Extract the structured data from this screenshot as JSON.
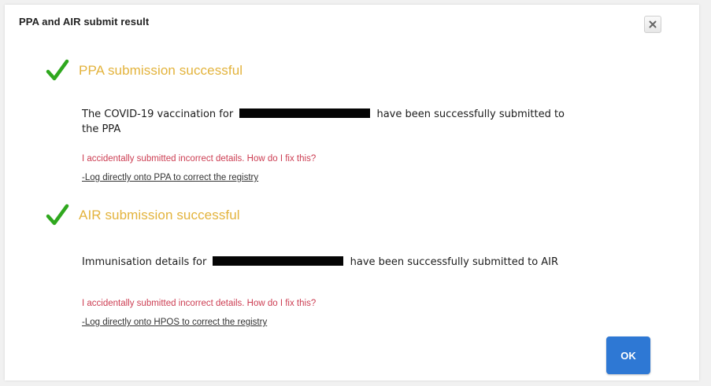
{
  "dialog": {
    "title": "PPA and AIR submit result",
    "close_icon": "close-x-icon",
    "ok_label": "OK"
  },
  "sections": [
    {
      "icon": "checkmark-icon",
      "heading": "PPA submission successful",
      "message_prefix": "The COVID-19 vaccination for",
      "message_suffix": "have been successfully submitted to",
      "message_line2": "the PPA",
      "help_question": "I accidentally submitted incorrect details. How do I fix this?",
      "fix_link": "-Log directly onto PPA to correct the registry"
    },
    {
      "icon": "checkmark-icon",
      "heading": "AIR submission successful",
      "message_prefix": "Immunisation details for",
      "message_suffix": "have been successfully submitted to AIR",
      "help_question": "I accidentally submitted incorrect details. How do I fix this?",
      "fix_link": "-Log directly onto HPOS to correct the registry"
    }
  ],
  "colors": {
    "heading": "#e3b33c",
    "check": "#2fa81e",
    "help_text": "#cc3d52",
    "ok_button": "#2e78d4"
  }
}
